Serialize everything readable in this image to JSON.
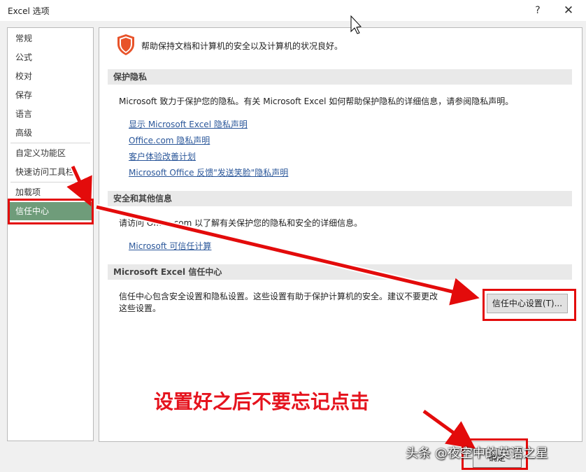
{
  "window": {
    "title": "Excel 选项",
    "help_label": "?",
    "close_label": "✕"
  },
  "sidebar": {
    "items": [
      {
        "label": "常规"
      },
      {
        "label": "公式"
      },
      {
        "label": "校对"
      },
      {
        "label": "保存"
      },
      {
        "label": "语言"
      },
      {
        "label": "高级"
      },
      {
        "label": "自定义功能区"
      },
      {
        "label": "快速访问工具栏"
      },
      {
        "label": "加载项"
      },
      {
        "label": "信任中心"
      }
    ],
    "selected": "信任中心"
  },
  "content": {
    "intro": "帮助保持文档和计算机的安全以及计算机的状况良好。",
    "intro_icon": "shield-icon",
    "privacy": {
      "header": "保护隐私",
      "text": "Microsoft 致力于保护您的隐私。有关 Microsoft Excel 如何帮助保护隐私的详细信息，请参阅隐私声明。",
      "links": [
        "显示 Microsoft Excel 隐私声明",
        "Office.com 隐私声明",
        "客户体验改善计划",
        "Microsoft Office 反馈\"发送笑脸\"隐私声明"
      ]
    },
    "security": {
      "header": "安全和其他信息",
      "text": "请访问 Office.com 以了解有关保护您的隐私和安全的详细信息。",
      "link": "Microsoft 可信任计算"
    },
    "trust_center": {
      "header": "Microsoft Excel 信任中心",
      "text_line1": "信任中心包含安全设置和隐私设置。这些设置有助于保护计算机的安全。建议不要更改",
      "text_line2": "这些设置。",
      "button": "信任中心设置(T)..."
    }
  },
  "footer": {
    "ok_button": "确定"
  },
  "annotation": {
    "text": "设置好之后不要忘记点击",
    "color": "#e5141e"
  },
  "watermark": {
    "text": "头条 @夜空中的英语之星"
  },
  "colors": {
    "selected_bg": "#6f9c7a",
    "link": "#2b579a",
    "shield": "#e8532a",
    "arrow": "#e30b0b"
  }
}
